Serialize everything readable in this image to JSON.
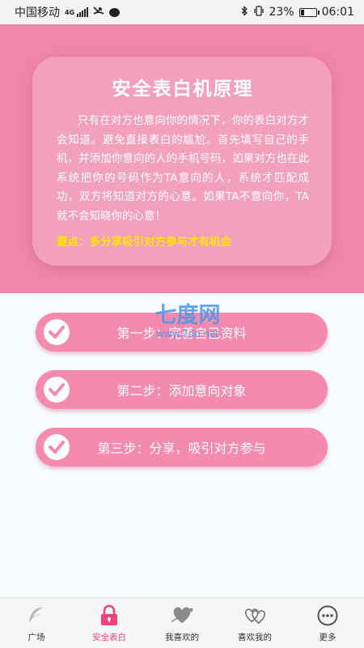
{
  "status_bar": {
    "carrier": "中国移动",
    "network": "4G",
    "battery": "23%",
    "battery_level": 0.23,
    "time": "06:01"
  },
  "intro_card": {
    "title": "安全表白机原理",
    "body": "只有在对方也意向你的情况下，你的表白对方才会知道。避免直接表白的尴尬。首先填写自己的手机，并添加你意向的人的手机号码，如果对方也在此系统把你的号码作为TA意向的人，系统才匹配成功，双方将知道对方的心意。如果TA不意向你，TA就不会知晓你的心意！",
    "key_point": "要点：多分享吸引对方参与才有机会"
  },
  "steps": [
    {
      "label": "第一步：完善自己资料",
      "icon": "check-icon"
    },
    {
      "label": "第二步：添加意向对象",
      "icon": "check-icon"
    },
    {
      "label": "第三步：分享，吸引对方参与",
      "icon": "check-icon"
    }
  ],
  "watermark": {
    "main": "七度网",
    "sub": "www.7do.net"
  },
  "bottom_nav": {
    "items": [
      {
        "label": "广场",
        "icon": "wing-icon"
      },
      {
        "label": "安全表白",
        "icon": "lock-icon",
        "active": true
      },
      {
        "label": "我喜欢的",
        "icon": "heart-arrow-icon"
      },
      {
        "label": "喜欢我的",
        "icon": "hearts-icon"
      },
      {
        "label": "更多",
        "icon": "more-icon"
      }
    ]
  },
  "colors": {
    "header": "#ef86ab",
    "step": "#f48aae",
    "key_point": "#ffe600",
    "active_nav": "#f0457a"
  }
}
